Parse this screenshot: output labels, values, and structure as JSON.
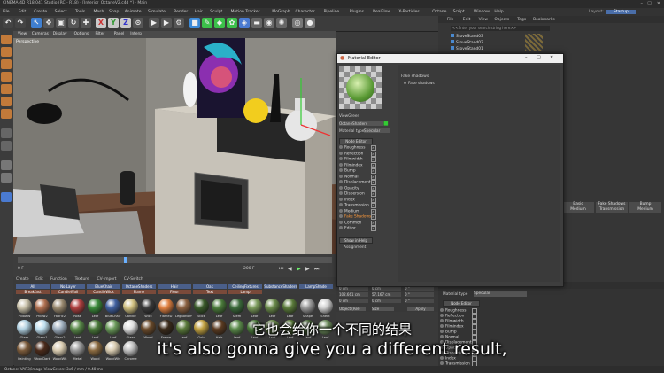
{
  "window_title": "CINEMA 4D R18.041 Studio (RC - R18) - [Interior_OctaneV2.c4d *] - Main",
  "menu": [
    "File",
    "Edit",
    "Create",
    "Select",
    "Tools",
    "Mesh",
    "Snap",
    "Animate",
    "Simulate",
    "Render",
    "Hair",
    "Sculpt",
    "Motion Tracker",
    "MoGraph",
    "Character",
    "Pipeline",
    "Plugins",
    "RealFlow",
    "X-Particles",
    "Octane",
    "Script",
    "Window",
    "Help"
  ],
  "right_menu": [
    "File",
    "Edit",
    "View",
    "Objects",
    "Tags",
    "Bookmarks"
  ],
  "layout_label": "Layout:",
  "layout_value": "Startup",
  "search_placeholder": "<<Enter your search string here>>",
  "objects": [
    "StoveStand03",
    "StoveStand02",
    "StoveStand01"
  ],
  "viewport": {
    "menu": [
      "View",
      "Cameras",
      "Display",
      "Options",
      "Filter",
      "Panel",
      "Interp"
    ],
    "label": "Perspective"
  },
  "timeline": {
    "start": "0 F",
    "end": "200 F",
    "current": "0 F"
  },
  "material_menu": [
    "Create",
    "Edit",
    "Function",
    "Texture",
    "CV-Import",
    "CV-Switch"
  ],
  "material_filters": [
    {
      "label": "All",
      "color": "#4a5f8a"
    },
    {
      "label": "No Layer",
      "color": "#4a5f8a"
    },
    {
      "label": "BlueChair",
      "color": "#4a5f8a"
    },
    {
      "label": "OctaneShaders",
      "color": "#4a5f8a"
    },
    {
      "label": "Hair",
      "color": "#4a5f8a"
    },
    {
      "label": "Oak",
      "color": "#4a5f8a"
    },
    {
      "label": "CeilingFixtures",
      "color": "#4a5f8a"
    },
    {
      "label": "SubstanceShaders",
      "color": "#4a5f8a"
    },
    {
      "label": "LampShade",
      "color": "#4a5f8a"
    },
    {
      "label": "Breakfast",
      "color": "#7a4a3a"
    },
    {
      "label": "CandleWall",
      "color": "#7a4a3a"
    },
    {
      "label": "CandleWick",
      "color": "#7a4a3a"
    },
    {
      "label": "Flame",
      "color": "#7a4a3a"
    },
    {
      "label": "Floor",
      "color": "#7a4a3a"
    },
    {
      "label": "Text",
      "color": "#7a4a3a"
    },
    {
      "label": "Lamp",
      "color": "#7a4a3a"
    }
  ],
  "materials_row1": [
    "PillowW",
    "Pillow2",
    "Fabric2",
    "Rose",
    "Leaf",
    "BlueChair",
    "Candle",
    "Wick",
    "FlameD",
    "LegBottom",
    "Stick",
    "Leaf",
    "Stem",
    "Leaf",
    "Leaf",
    "Leaf",
    "Shape",
    "Sheet"
  ],
  "materials_row2": [
    "Glass",
    "Glass1",
    "Glass2",
    "Leaf",
    "Leaf",
    "Leaf",
    "Glass",
    "Wood",
    "Frame",
    "Leaf",
    "Gold",
    "Hair",
    "Leaf",
    "Leaf",
    "Leaf",
    "Leaf",
    "Leaf",
    "Leaf"
  ],
  "materials_row3": [
    "Painting",
    "WoodDark",
    "WoodWh",
    "Metal",
    "Wood",
    "WoodWh",
    "Chrome"
  ],
  "status_text": "Octane: VAR3/image ViewGreen: 3x6 / mm / 0.40 ms",
  "material_editor": {
    "title": "Material Editor",
    "material_name": "ViewGreen",
    "shader_label": "OctaneShaders",
    "material_type_label": "Material type",
    "material_type_value": "Specular",
    "node_editor_button": "Node Editor",
    "section_title": "Fake shadows",
    "section_option": "Fake shadows",
    "channels": [
      {
        "label": "Roughness",
        "checked": true
      },
      {
        "label": "Reflection",
        "checked": true
      },
      {
        "label": "Filmwidth",
        "checked": true
      },
      {
        "label": "Filmindex",
        "checked": true
      },
      {
        "label": "Bump",
        "checked": true
      },
      {
        "label": "Normal",
        "checked": true
      },
      {
        "label": "Displacement",
        "checked": true
      },
      {
        "label": "Opacity",
        "checked": true
      },
      {
        "label": "Dispersion",
        "checked": true
      },
      {
        "label": "Index",
        "checked": true
      },
      {
        "label": "Transmission",
        "checked": true
      },
      {
        "label": "Medium",
        "checked": true
      },
      {
        "label": "Fake Shadows",
        "checked": true,
        "active": true
      },
      {
        "label": "Common",
        "checked": true
      },
      {
        "label": "Editor",
        "checked": true
      }
    ],
    "show_in_help": "Show in Help",
    "assignment": "Assignment"
  },
  "coords": {
    "rows": [
      [
        "0 cm",
        "0 cm",
        "0 °"
      ],
      [
        "102.661 cm",
        "57.167 cm",
        "0 °"
      ],
      [
        "0 cm",
        "0 cm",
        "0 °"
      ]
    ],
    "mode": "Object (Rel)",
    "size": "Size",
    "apply": "Apply"
  },
  "attributes": {
    "tabs": [
      "Basic",
      "Fake Shadows",
      "Bump",
      "Medium",
      "Transmission",
      "Medium"
    ],
    "material_type_label": "Material type",
    "material_type_value": "Specular",
    "node_editor": "Node Editor",
    "channels": [
      "Roughness",
      "Reflection",
      "Filmwidth",
      "Filmindex",
      "Bump",
      "Normal",
      "Displacement",
      "Opacity",
      "Dispersion",
      "Index",
      "Transmission"
    ]
  },
  "subtitle_cn": "它也会给你一个不同的结果",
  "subtitle_en": "it's also gonna give you a different result,"
}
